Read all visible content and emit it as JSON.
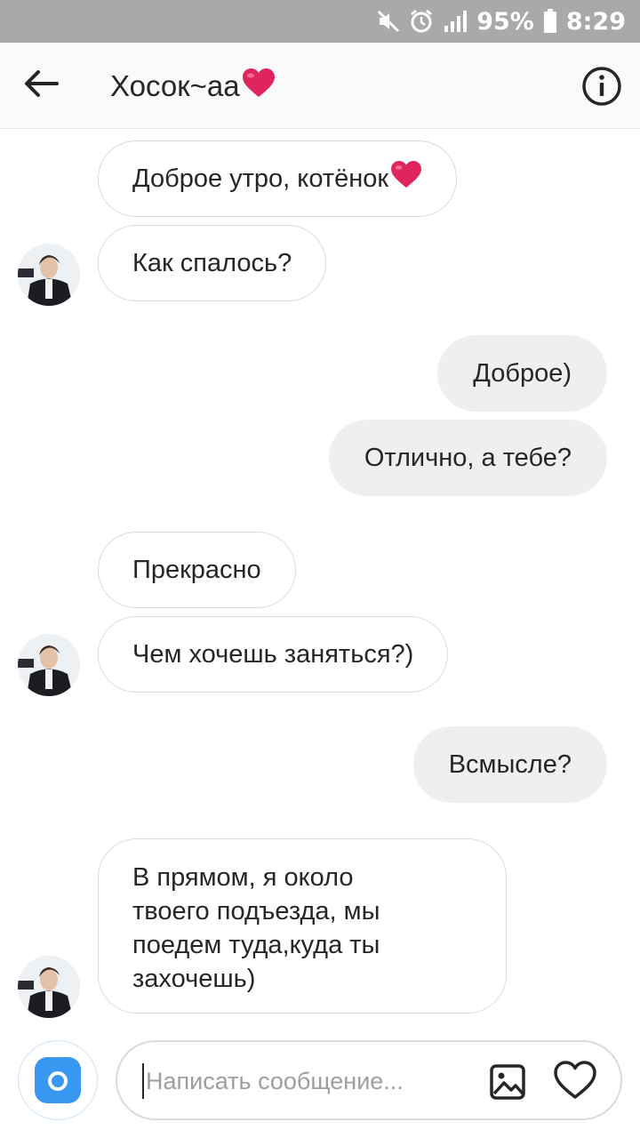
{
  "status_bar": {
    "battery": "95%",
    "time": "8:29",
    "icons": [
      "mute-icon",
      "alarm-icon",
      "signal-icon",
      "battery-icon"
    ]
  },
  "header": {
    "title": "Хосок~аа",
    "title_emoji": "heart-emoji",
    "back_icon": "arrow-left-icon",
    "info_icon": "info-icon"
  },
  "messages": [
    {
      "side": "in",
      "text": "Доброе утро, котёнок",
      "emoji": "heart-emoji"
    },
    {
      "side": "in",
      "text": "Как спалось?",
      "avatar": true
    },
    {
      "side": "out",
      "text": "Доброе)"
    },
    {
      "side": "out",
      "text": "Отлично, а тебе?"
    },
    {
      "side": "in",
      "text": "Прекрасно"
    },
    {
      "side": "in",
      "text": "Чем хочешь заняться?)",
      "avatar": true
    },
    {
      "side": "out",
      "text": "Всмысле?"
    },
    {
      "side": "in",
      "lines": [
        "В прямом, я около",
        "твоего подъезда, мы",
        "поедем туда,куда ты",
        "захочешь)"
      ],
      "avatar": true
    }
  ],
  "composer": {
    "placeholder": "Написать сообщение...",
    "value": "",
    "camera_icon": "camera-icon",
    "gallery_icon": "image-icon",
    "like_icon": "heart-icon"
  },
  "colors": {
    "status_bar": "#a9a9a9",
    "incoming_border": "#dbdbdb",
    "outgoing_bg": "#efefef",
    "camera_accent": "#3897f0",
    "heart_red": "#e0245e"
  }
}
